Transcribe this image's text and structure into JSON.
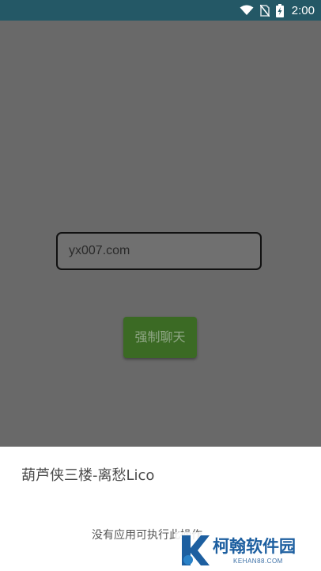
{
  "status_bar": {
    "time": "2:00",
    "icons": [
      "wifi-icon",
      "no-sim-icon",
      "battery-charging-icon"
    ],
    "background": "#245866"
  },
  "main": {
    "input_value": "yx007.com",
    "button_label": "强制聊天",
    "button_color": "#3b6a24"
  },
  "sheet": {
    "title": "葫芦侠三楼-离愁Lico",
    "message": "没有应用可执行此操作"
  },
  "watermark": {
    "brand": "柯翰软件园",
    "domain": "KEHAN88.COM",
    "logo_icon": "k-logo-icon"
  }
}
